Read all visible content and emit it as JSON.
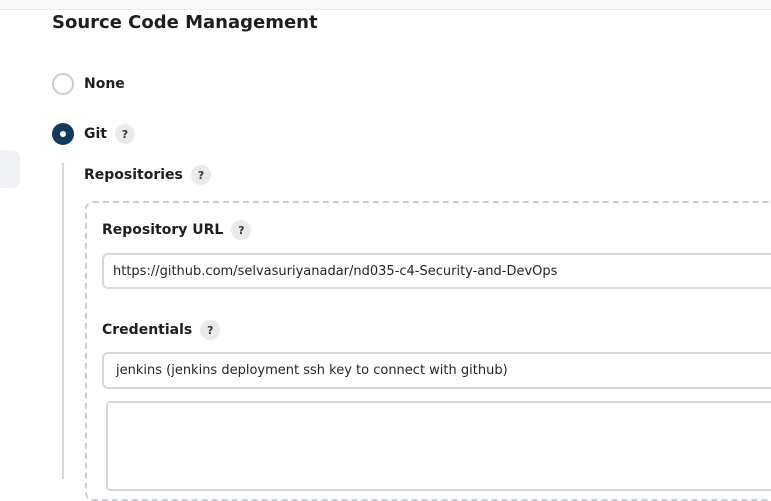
{
  "section": {
    "title": "Source Code Management"
  },
  "scm_options": [
    {
      "label": "None",
      "selected": false
    },
    {
      "label": "Git",
      "selected": true
    }
  ],
  "help_glyph": "?",
  "git": {
    "repositories_label": "Repositories",
    "repository_url": {
      "label": "Repository URL",
      "value": "https://github.com/selvasuriyanadar/nd035-c4-Security-and-DevOps"
    },
    "credentials": {
      "label": "Credentials",
      "selected": "jenkins (jenkins deployment ssh key to connect with github)"
    },
    "refspec_value": ""
  },
  "colors": {
    "radio_checked": "#123b5b",
    "help_bg": "#e9eaec",
    "border": "#d4d7dc"
  }
}
